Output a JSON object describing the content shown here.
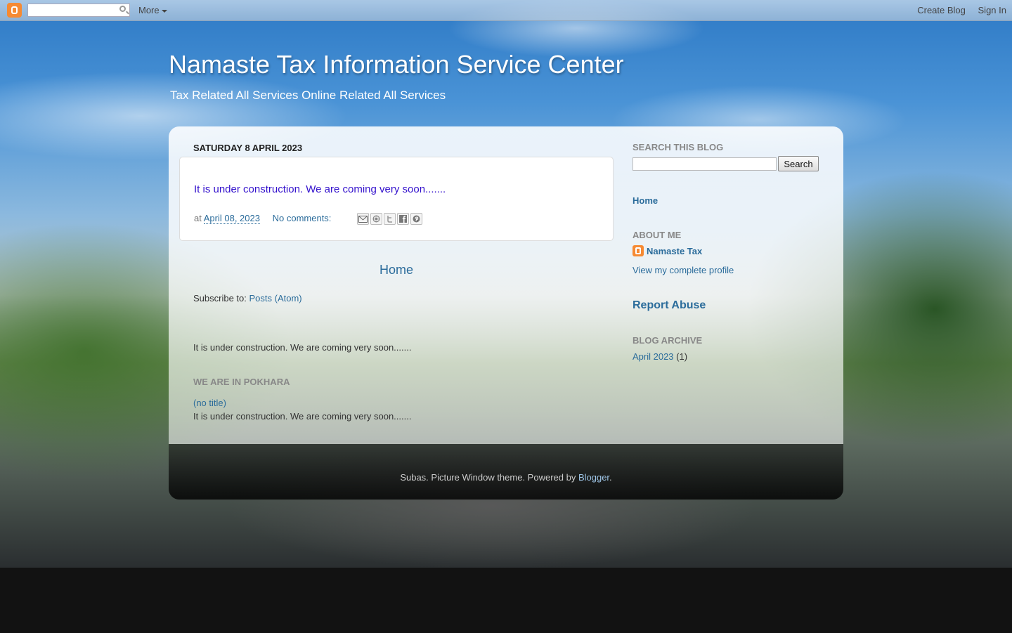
{
  "navbar": {
    "search_placeholder": "",
    "more_label": "More",
    "create_blog_label": "Create Blog",
    "sign_in_label": "Sign In"
  },
  "header": {
    "title": "Namaste Tax Information Service Center",
    "description": "Tax Related All Services Online Related All Services"
  },
  "main": {
    "date_header": "SATURDAY 8 APRIL 2023",
    "post": {
      "body": "It is under construction. We are coming very soon.......",
      "footer_prefix": "at",
      "date_link": "April 08, 2023",
      "comments_link": "No comments:",
      "share_buttons": [
        "email-icon",
        "blogthis-icon",
        "twitter-icon",
        "facebook-icon",
        "pinterest-icon"
      ]
    },
    "home_label": "Home",
    "subscribe_prefix": "Subscribe to:",
    "subscribe_link": "Posts (Atom)",
    "text_block_1": "It is under construction. We are coming very soon.......",
    "pokhara_heading": "WE ARE IN POKHARA",
    "no_title_link": "(no title)",
    "text_block_2": "It is under construction. We are coming very soon......."
  },
  "sidebar": {
    "search_heading": "SEARCH THIS BLOG",
    "search_button": "Search",
    "home_link": "Home",
    "about_heading": "ABOUT ME",
    "profile_name": "Namaste Tax",
    "profile_link": "View my complete profile",
    "report_abuse": "Report Abuse",
    "archive_heading": "BLOG ARCHIVE",
    "archive_month": "April 2023",
    "archive_count": "(1)"
  },
  "footer": {
    "text_prefix": "Subas. Picture Window theme. Powered by",
    "blogger_link": "Blogger",
    "text_suffix": "."
  },
  "colors": {
    "link": "#2b6c9b",
    "post_body_text": "#3311cc",
    "blogger_orange": "#f68a33"
  }
}
